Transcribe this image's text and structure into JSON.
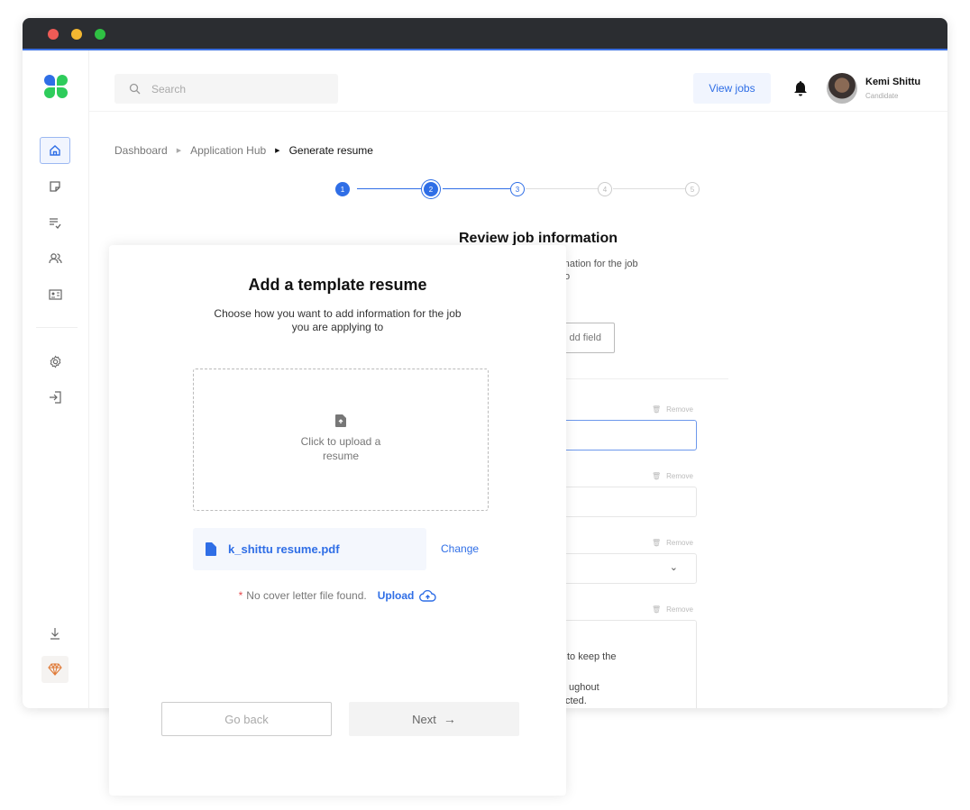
{
  "window": {
    "controls": [
      "close",
      "minimize",
      "maximize"
    ]
  },
  "sidebar": {
    "items": [
      {
        "icon": "home-icon",
        "active": true
      },
      {
        "icon": "note-icon"
      },
      {
        "icon": "list-edit-icon"
      },
      {
        "icon": "users-icon"
      },
      {
        "icon": "id-card-icon"
      },
      {
        "icon": "gear-icon"
      },
      {
        "icon": "login-icon"
      },
      {
        "icon": "download-icon"
      },
      {
        "icon": "sketch-icon"
      }
    ]
  },
  "header": {
    "search_placeholder": "Search",
    "view_jobs": "View jobs",
    "user_name": "Kemi Shittu",
    "user_role": "Candidate"
  },
  "breadcrumb": [
    "Dashboard",
    "Application Hub",
    "Generate resume"
  ],
  "stepper": {
    "steps": [
      "1",
      "2",
      "3",
      "4",
      "5"
    ],
    "current": 2
  },
  "background": {
    "title": "Review job information",
    "desc_line1": "rmation for the job",
    "desc_line2": "to",
    "add_field": "dd field",
    "remove": "Remove",
    "textarea_lines": [
      "to keep the",
      "ughout",
      "cted."
    ]
  },
  "modal": {
    "title": "Add a template resume",
    "subtitle_line1": "Choose how you want to add information for the job",
    "subtitle_line2": "you are applying to",
    "upload_line1": "Click to upload a",
    "upload_line2": "resume",
    "file_name": "k_shittu resume.pdf",
    "change": "Change",
    "asterisk": "*",
    "cover_note": "No cover letter file found.",
    "upload": "Upload",
    "go_back": "Go back",
    "next": "Next"
  },
  "colors": {
    "accent": "#2f6ee6",
    "titlebar": "#2b2d31",
    "required": "#e5484d",
    "sketch": "#e07b39"
  }
}
